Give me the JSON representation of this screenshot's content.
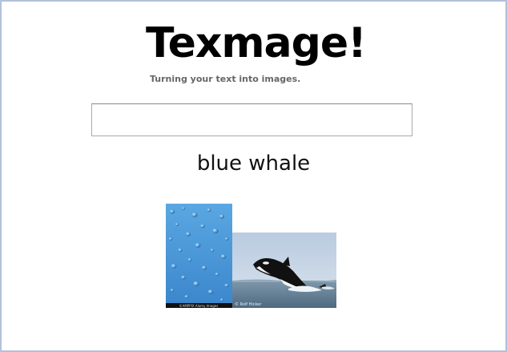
{
  "app": {
    "title": "Texmage!",
    "tagline": "Turning your text into images."
  },
  "search": {
    "value": "",
    "placeholder": ""
  },
  "result": {
    "query": "blue whale",
    "images": [
      {
        "name": "water-droplets-image",
        "credit": "©AMPPIX Alamy Images"
      },
      {
        "name": "orca-breaching-image",
        "credit": "© Rolf Hicker"
      }
    ]
  },
  "colors": {
    "border": "#b4c0dc",
    "water": "#4a98d8",
    "sky": "#c8d8e8",
    "sea": "#5a7a90"
  }
}
